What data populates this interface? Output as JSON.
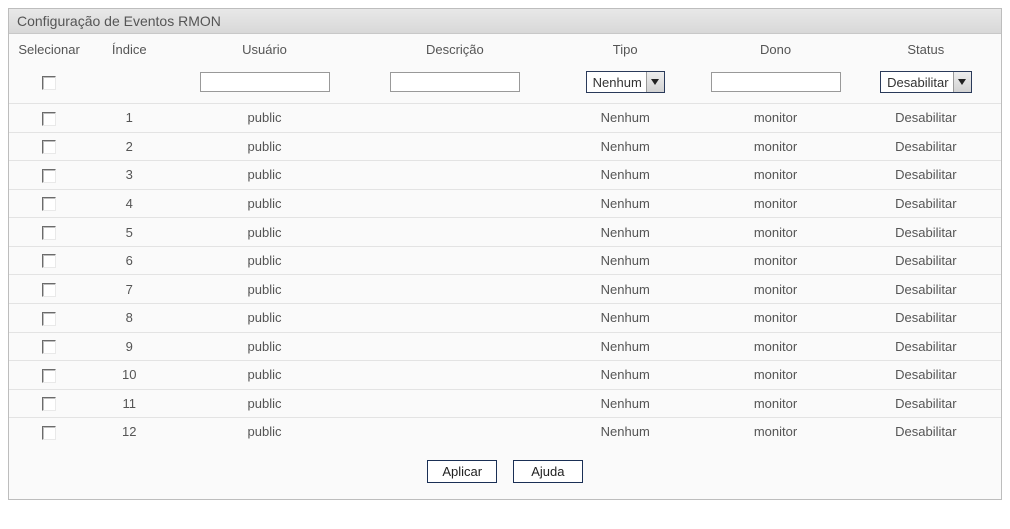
{
  "panel": {
    "title": "Configuração de Eventos RMON"
  },
  "headers": {
    "select": "Selecionar",
    "index": "Índice",
    "user": "Usuário",
    "description": "Descrição",
    "type": "Tipo",
    "owner": "Dono",
    "status": "Status"
  },
  "filters": {
    "user_value": "",
    "description_value": "",
    "owner_value": "",
    "type_selected": "Nenhum",
    "status_selected": "Desabilitar"
  },
  "rows": [
    {
      "index": "1",
      "user": "public",
      "description": "",
      "type": "Nenhum",
      "owner": "monitor",
      "status": "Desabilitar"
    },
    {
      "index": "2",
      "user": "public",
      "description": "",
      "type": "Nenhum",
      "owner": "monitor",
      "status": "Desabilitar"
    },
    {
      "index": "3",
      "user": "public",
      "description": "",
      "type": "Nenhum",
      "owner": "monitor",
      "status": "Desabilitar"
    },
    {
      "index": "4",
      "user": "public",
      "description": "",
      "type": "Nenhum",
      "owner": "monitor",
      "status": "Desabilitar"
    },
    {
      "index": "5",
      "user": "public",
      "description": "",
      "type": "Nenhum",
      "owner": "monitor",
      "status": "Desabilitar"
    },
    {
      "index": "6",
      "user": "public",
      "description": "",
      "type": "Nenhum",
      "owner": "monitor",
      "status": "Desabilitar"
    },
    {
      "index": "7",
      "user": "public",
      "description": "",
      "type": "Nenhum",
      "owner": "monitor",
      "status": "Desabilitar"
    },
    {
      "index": "8",
      "user": "public",
      "description": "",
      "type": "Nenhum",
      "owner": "monitor",
      "status": "Desabilitar"
    },
    {
      "index": "9",
      "user": "public",
      "description": "",
      "type": "Nenhum",
      "owner": "monitor",
      "status": "Desabilitar"
    },
    {
      "index": "10",
      "user": "public",
      "description": "",
      "type": "Nenhum",
      "owner": "monitor",
      "status": "Desabilitar"
    },
    {
      "index": "11",
      "user": "public",
      "description": "",
      "type": "Nenhum",
      "owner": "monitor",
      "status": "Desabilitar"
    },
    {
      "index": "12",
      "user": "public",
      "description": "",
      "type": "Nenhum",
      "owner": "monitor",
      "status": "Desabilitar"
    }
  ],
  "buttons": {
    "apply": "Aplicar",
    "help": "Ajuda"
  }
}
